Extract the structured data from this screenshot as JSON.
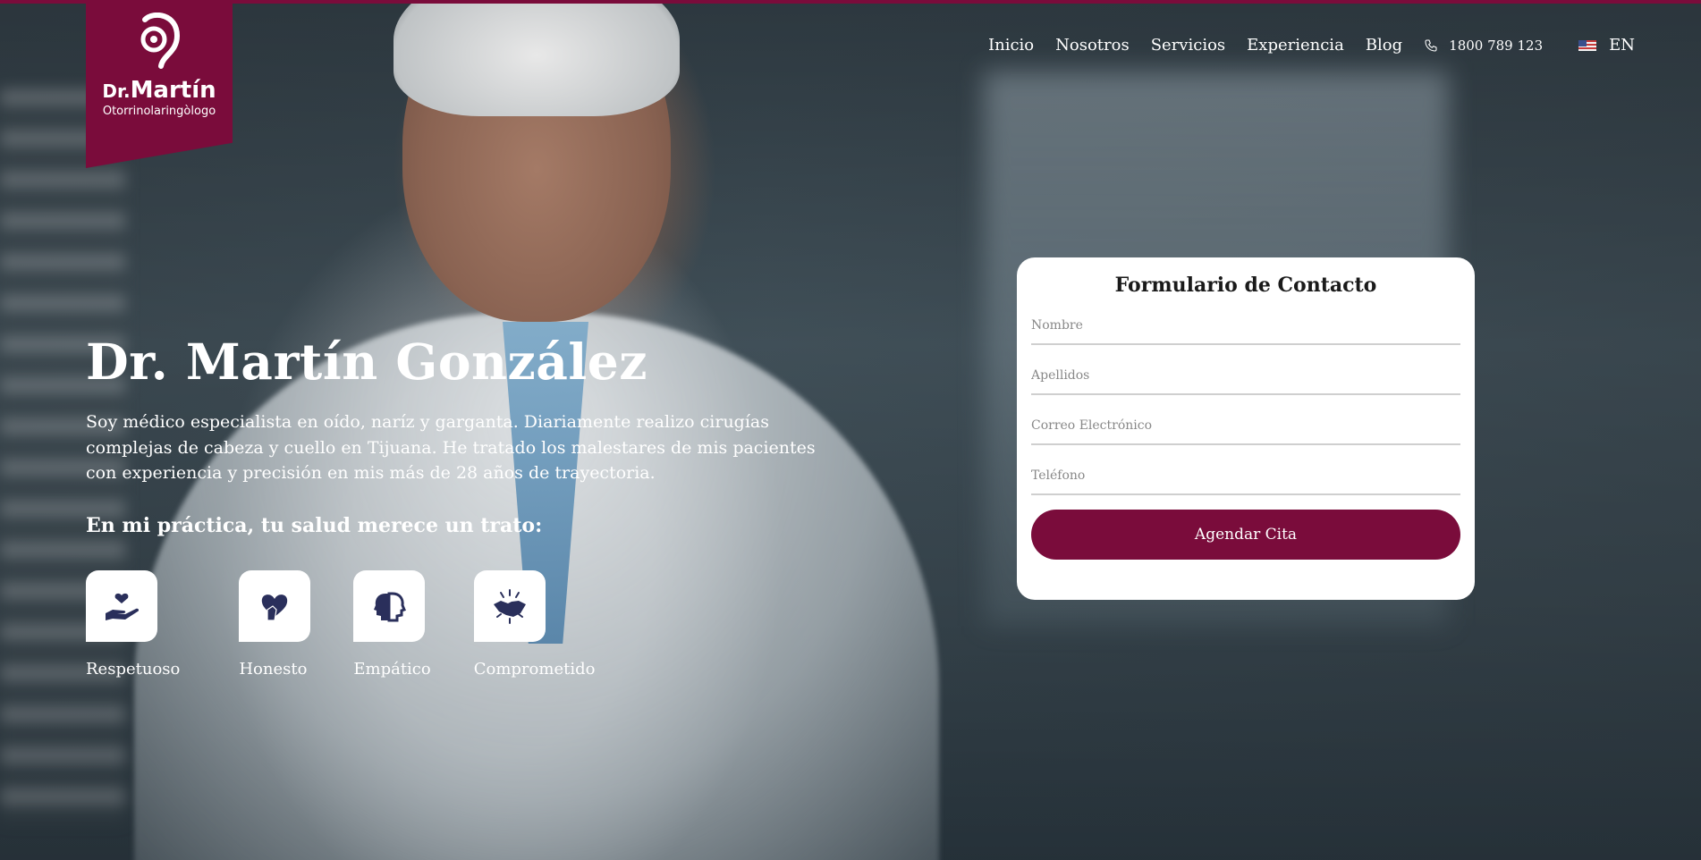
{
  "brand": {
    "name_prefix": "Dr.",
    "name": "Martín",
    "subtitle": "Otorrinolaringòlogo",
    "color": "#7a0c3b"
  },
  "nav": {
    "items": [
      "Inicio",
      "Nosotros",
      "Servicios",
      "Experiencia",
      "Blog"
    ],
    "phone": "1800 789 123",
    "phone_icon": "phone-icon",
    "language": "EN",
    "flag_icon": "us-flag-icon"
  },
  "hero": {
    "title": "Dr. Martín González",
    "description": "Soy médico especialista en oído, naríz y garganta. Diariamente realizo cirugías complejas de cabeza y cuello en Tijuana. He tratado los malestares de mis pacientes con experiencia y precisión en mis más de 28 años de trayectoria.",
    "subtitle": "En mi práctica, tu salud merece un trato:",
    "values": [
      {
        "label": "Respetuoso",
        "icon": "caring-hand-icon"
      },
      {
        "label": "Honesto",
        "icon": "heart-hand-icon"
      },
      {
        "label": "Empático",
        "icon": "two-heads-icon"
      },
      {
        "label": "Comprometido",
        "icon": "handshake-icon"
      }
    ]
  },
  "contact_form": {
    "title": "Formulario de Contacto",
    "fields": {
      "nombre": {
        "placeholder": "Nombre",
        "value": ""
      },
      "apellidos": {
        "placeholder": "Apellidos",
        "value": ""
      },
      "correo": {
        "placeholder": "Correo Electrónico",
        "value": ""
      },
      "telefono": {
        "placeholder": "Teléfono",
        "value": ""
      }
    },
    "submit_label": "Agendar Cita"
  },
  "colors": {
    "accent": "#7a0c3b",
    "icon": "#2a2f5b"
  }
}
